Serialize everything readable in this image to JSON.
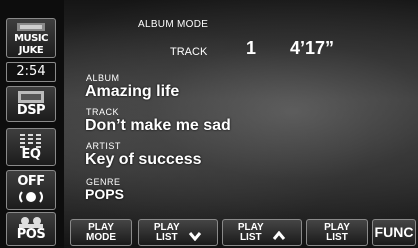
{
  "header": {
    "mode_title": "ALBUM MODE",
    "track_label": "TRACK",
    "track_number": "1",
    "track_time": "4’17”"
  },
  "sidebar": {
    "music_juke_line1": "MUSIC",
    "music_juke_line2": "JUKE",
    "clock": "2:54",
    "dsp_label": "DSP",
    "eq_label": "EQ",
    "off_label": "OFF",
    "pos_label": "POS"
  },
  "info": {
    "album_caption": "ALBUM",
    "album_value": "Amazing life",
    "track_caption": "TRACK",
    "track_value": "Don’t make me sad",
    "artist_caption": "ARTIST",
    "artist_value": "Key of success",
    "genre_caption": "GENRE",
    "genre_value": "POPS"
  },
  "bottom": {
    "play_mode_1": "PLAY",
    "play_mode_2": "MODE",
    "play_list_down_1": "PLAY",
    "play_list_down_2": "LIST",
    "play_list_up_1": "PLAY",
    "play_list_up_2": "LIST",
    "play_list_1": "PLAY",
    "play_list_2": "LIST",
    "func": "FUNC"
  }
}
